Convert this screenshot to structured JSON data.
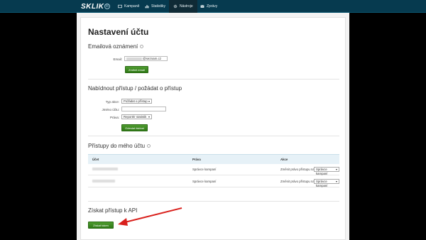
{
  "nav": {
    "logo": "SKLIK",
    "logo_icon": "B",
    "items": [
      {
        "label": "Kampaně",
        "icon": "campaign-icon"
      },
      {
        "label": "Statistiky",
        "icon": "chart-icon"
      },
      {
        "label": "Nástroje",
        "icon": "gear-icon",
        "active": true
      },
      {
        "label": "Zprávy",
        "icon": "envelope-icon"
      }
    ]
  },
  "page": {
    "title": "Nastavení účtu"
  },
  "email_section": {
    "title": "Emailová oznámení",
    "email_label": "Email:",
    "email_value": "@seznam.cz",
    "save_button": "Změnit email"
  },
  "access_section": {
    "title": "Nabídnout přístup / požádat o přístup",
    "type_label": "Typ akce:",
    "type_value": "Požádat o přístup",
    "account_label": "Jméno účtu:",
    "account_value": "",
    "rights_label": "Práva:",
    "rights_value": "Reportér statistik",
    "submit_button": "Odeslat žádost"
  },
  "my_access_section": {
    "title": "Přístupy do mého účtu",
    "columns": [
      "Účet",
      "Práva",
      "Akce"
    ],
    "rows": [
      {
        "rights": "Správce kampaní",
        "action_label": "Změnit právo přístupu na",
        "action_value": "Správce kampaní"
      },
      {
        "rights": "Správce kampaní",
        "action_label": "Změnit právo přístupu na",
        "action_value": "Správce kampaní"
      }
    ]
  },
  "api_section": {
    "title": "Získat přístup k API",
    "button": "Získat token"
  },
  "colors": {
    "topbar": "#063a4f",
    "button_green": "#3b8a22",
    "arrow_red": "#d9201c"
  }
}
